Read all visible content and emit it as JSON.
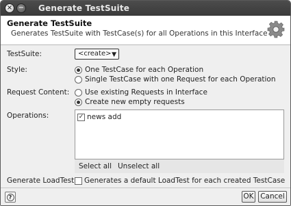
{
  "window": {
    "title": "Generate TestSuite",
    "close_glyph": "×",
    "min_glyph": "−"
  },
  "header": {
    "title": "Generate TestSuite",
    "description": "Generates TestSuite with TestCase(s) for all Operations in this Interface",
    "icon": "gear-icon"
  },
  "form": {
    "testsuite_label": "TestSuite:",
    "testsuite_value": "<create>",
    "style_label": "Style:",
    "style_options": [
      {
        "label": "One TestCase for each Operation",
        "selected": true
      },
      {
        "label": "Single TestCase with one Request for each Operation",
        "selected": false
      }
    ],
    "request_label": "Request Content:",
    "request_options": [
      {
        "label": "Use existing Requests in Interface",
        "selected": false
      },
      {
        "label": "Create new empty requests",
        "selected": true
      }
    ],
    "operations_label": "Operations:",
    "operations": [
      {
        "label": "news add",
        "checked": true
      }
    ],
    "select_all": "Select all",
    "unselect_all": "Unselect all",
    "loadtest_label": "Generate LoadTest:",
    "loadtest_option": "Generates a default LoadTest for each created TestCase",
    "loadtest_checked": false
  },
  "footer": {
    "help": "?",
    "ok": "OK",
    "cancel": "Cancel"
  }
}
